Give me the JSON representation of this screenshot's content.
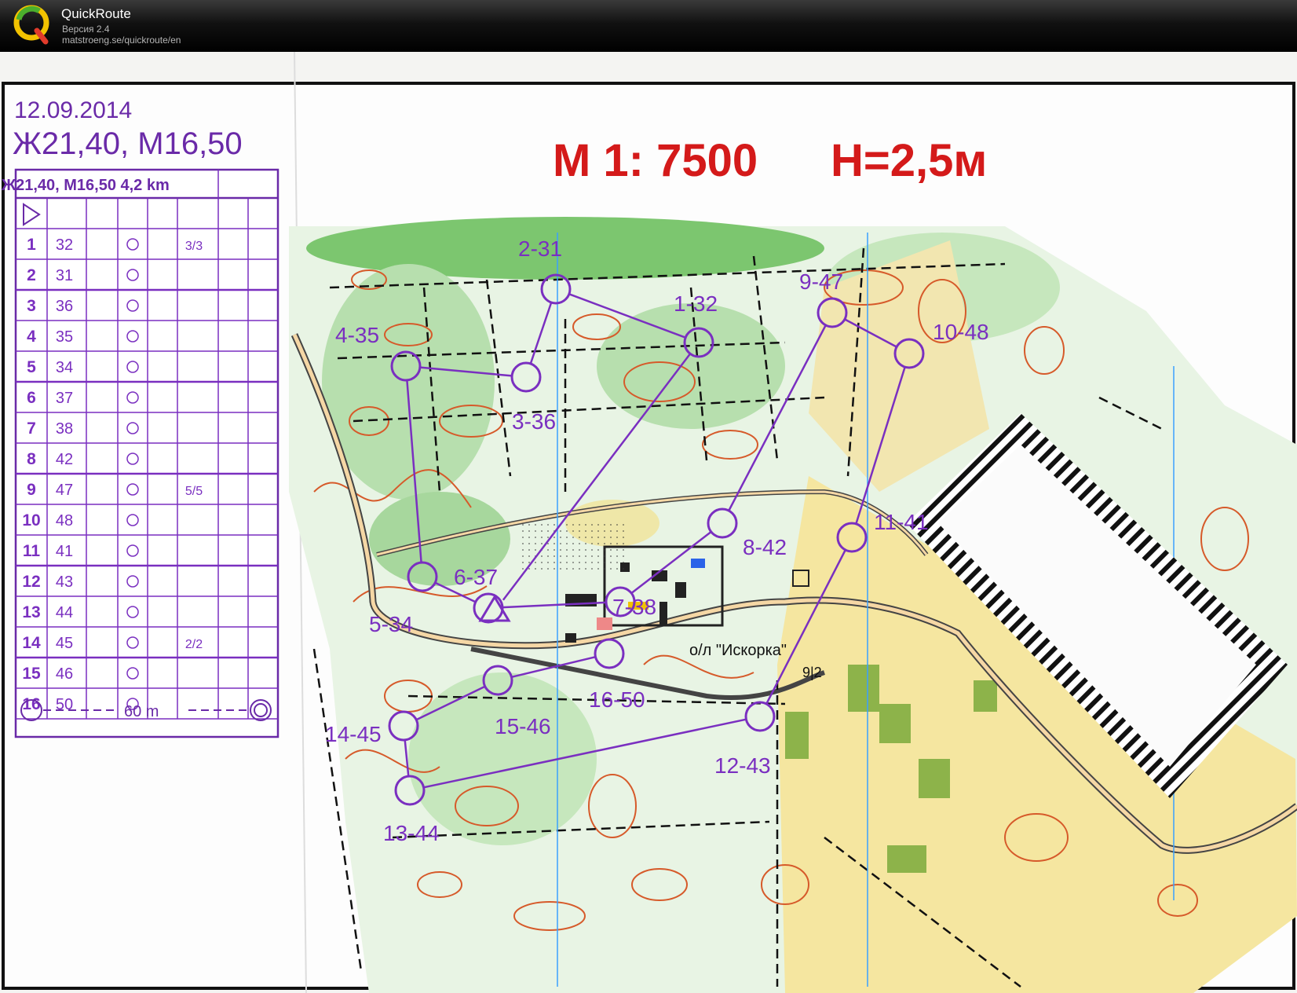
{
  "app": {
    "name": "QuickRoute",
    "version": "Версия 2.4",
    "url": "matstroeng.se/quickroute/en",
    "icon": "quickroute-logo-icon"
  },
  "map": {
    "date": "12.09.2014",
    "classes": "Ж21,40, М16,50",
    "scale": "М 1: 7500",
    "contour": "Н=2,5м",
    "camp_label": "о/л \"Искорка\"",
    "grid_label": "9|2"
  },
  "description_sheet": {
    "header": "Ж21,40, М16,50 4,2 km",
    "start_symbol": "start-triangle-icon",
    "rows": [
      {
        "num": "1",
        "code": "32",
        "extra": "3/3"
      },
      {
        "num": "2",
        "code": "31",
        "extra": ""
      },
      {
        "num": "3",
        "code": "36",
        "extra": ""
      },
      {
        "num": "4",
        "code": "35",
        "extra": ""
      },
      {
        "num": "5",
        "code": "34",
        "extra": ""
      },
      {
        "num": "6",
        "code": "37",
        "extra": ""
      },
      {
        "num": "7",
        "code": "38",
        "extra": ""
      },
      {
        "num": "8",
        "code": "42",
        "extra": ""
      },
      {
        "num": "9",
        "code": "47",
        "extra": "5/5"
      },
      {
        "num": "10",
        "code": "48",
        "extra": ""
      },
      {
        "num": "11",
        "code": "41",
        "extra": ""
      },
      {
        "num": "12",
        "code": "43",
        "extra": ""
      },
      {
        "num": "13",
        "code": "44",
        "extra": ""
      },
      {
        "num": "14",
        "code": "45",
        "extra": "2/2"
      },
      {
        "num": "15",
        "code": "46",
        "extra": ""
      },
      {
        "num": "16",
        "code": "50",
        "extra": ""
      }
    ],
    "footer": "60 m"
  },
  "controls": [
    {
      "label": "1-32"
    },
    {
      "label": "2-31"
    },
    {
      "label": "3-36"
    },
    {
      "label": "4-35"
    },
    {
      "label": "5-34"
    },
    {
      "label": "6-37"
    },
    {
      "label": "7-38"
    },
    {
      "label": "8-42"
    },
    {
      "label": "9-47"
    },
    {
      "label": "10-48"
    },
    {
      "label": "11-41"
    },
    {
      "label": "12-43"
    },
    {
      "label": "13-44"
    },
    {
      "label": "14-45"
    },
    {
      "label": "15-46"
    },
    {
      "label": "16-50"
    }
  ],
  "colors": {
    "course": "#7a2fc0",
    "contour": "#d65a2a",
    "scale_text": "#d41a1a",
    "vegetation": "#8fd08a",
    "open_land": "#f2e27a",
    "water_line": "#3aa0ff",
    "text_purple": "#6a2aa8"
  }
}
